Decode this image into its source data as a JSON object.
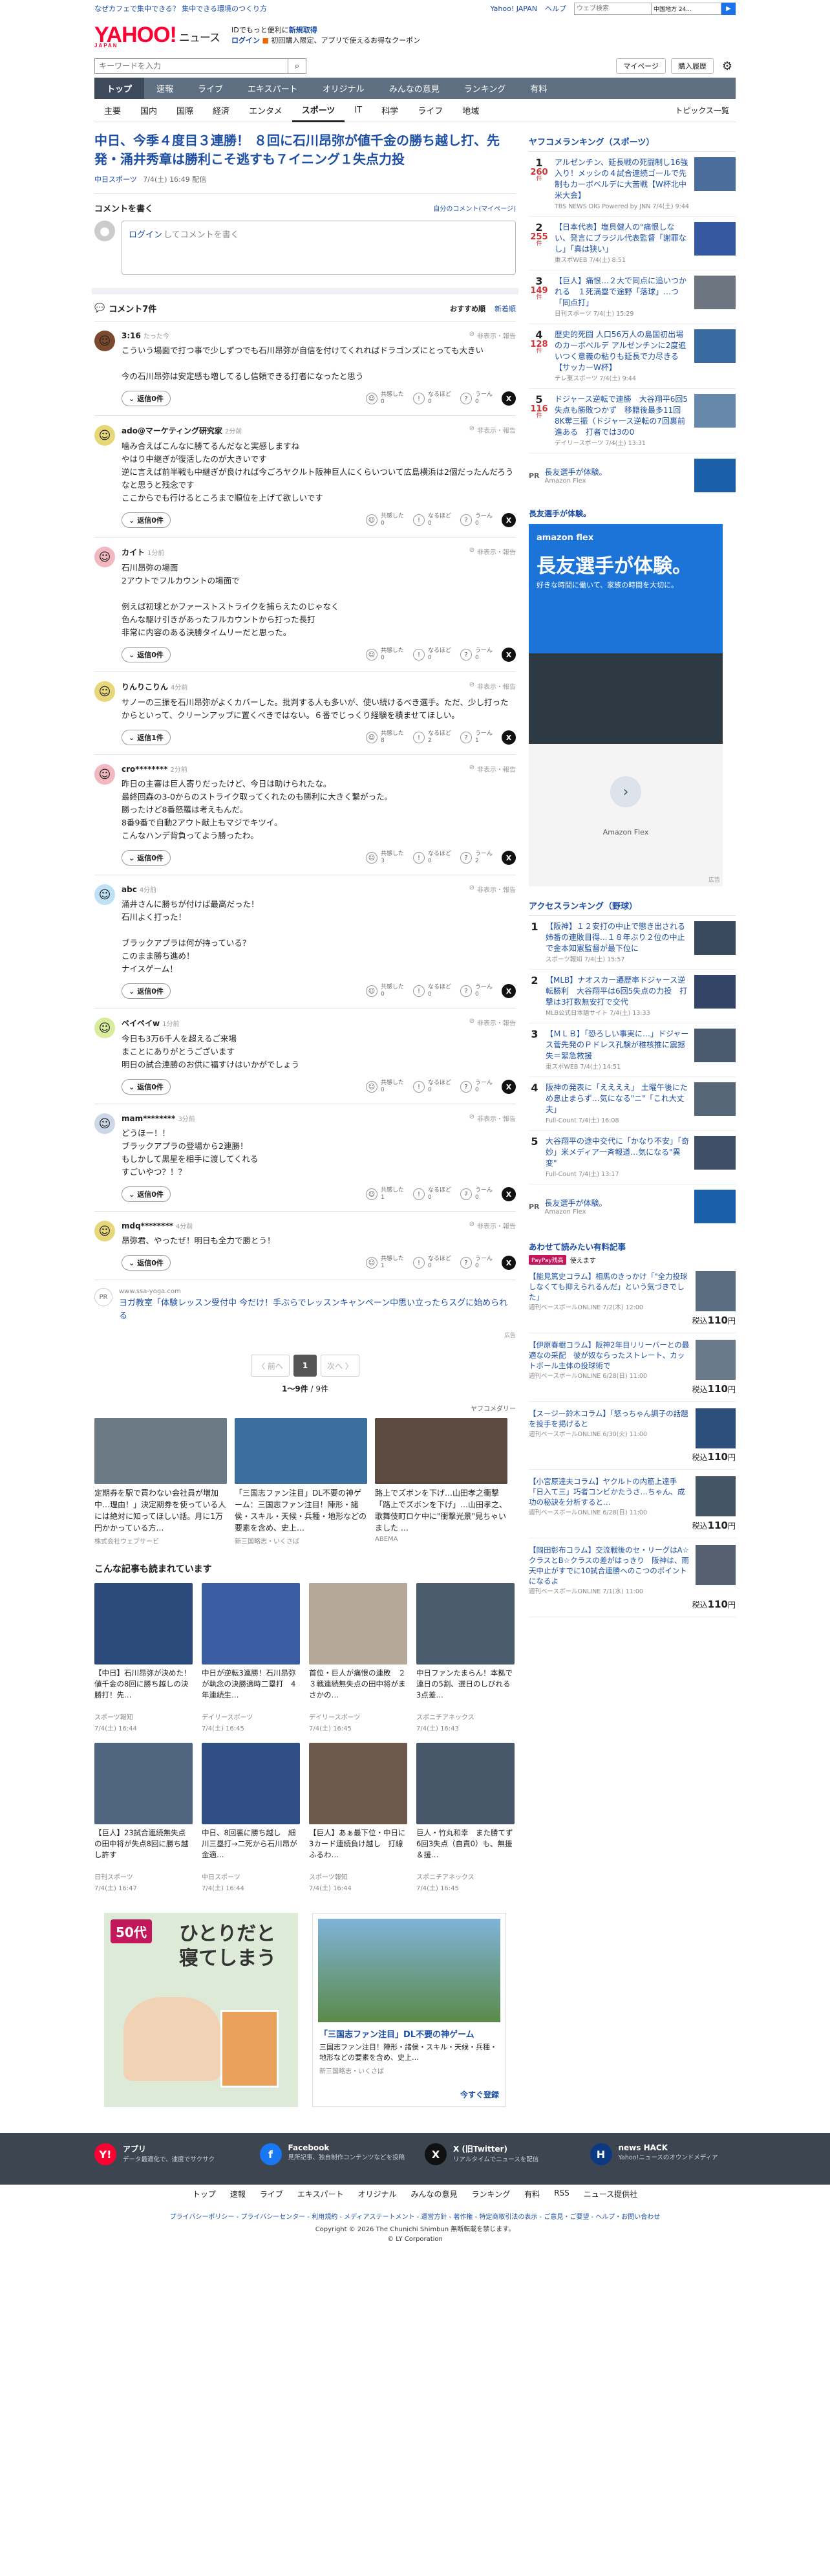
{
  "topbar": {
    "promo": "なぜカフェで集中できる？ 集中できる環境のつくり方",
    "links": [
      "Yahoo! JAPAN",
      "ヘルプ"
    ],
    "search_placeholder": "ウェブ検索",
    "search_select": "中国地方 24...",
    "search_button": "▶"
  },
  "header": {
    "logo": "YAHOO!",
    "logo_sub": "JAPAN",
    "news": "ニュース",
    "promo1_pre": "IDでもっと便利に",
    "promo1_link": "新規取得",
    "promo2_link": "ログイン",
    "promo2_text": "初回購入限定、アプリで使えるお得なクーポン"
  },
  "search": {
    "placeholder": "キーワードを入力",
    "mypage": "マイページ",
    "purchased": "購入履歴"
  },
  "gnav": [
    "トップ",
    "速報",
    "ライブ",
    "エキスパート",
    "オリジナル",
    "みんなの意見",
    "ランキング",
    "有料"
  ],
  "snav": [
    "主要",
    "国内",
    "国際",
    "経済",
    "エンタメ",
    "スポーツ",
    "IT",
    "科学",
    "ライフ",
    "地域"
  ],
  "topics_list": "トピックス一覧",
  "article": {
    "title": "中日、今季４度目３連勝！ ８回に石川昂弥が値千金の勝ち越し打、先発・涌井秀章は勝利こそ逃すも７イニング１失点力投",
    "source": "中日スポーツ",
    "date": "7/4(土) 16:49 配信"
  },
  "comment_form": {
    "heading": "コメントを書く",
    "mine": "自分のコメント(マイページ)",
    "login": "ログイン",
    "placeholder": "してコメントを書く"
  },
  "comments_head": {
    "title": "コメント7件",
    "sort_rec": "おすすめ順",
    "sort_new": "新着順"
  },
  "react_labels": {
    "agree": "共感した",
    "hmm": "なるほど",
    "think": "うーん",
    "reply": "返信0件",
    "report": "非表示・報告"
  },
  "comments": [
    {
      "name": "3:16",
      "ago": "たった今",
      "text": "こういう場面で打つ事で少しずつでも石川昂弥が自信を付けてくれればドラゴンズにとっても大きい\n\n今の石川昂弥は安定感も増してるし信頼できる打者になったと思う",
      "agree": "0",
      "hmm": "0",
      "think": "0",
      "reply": "返信0件",
      "color": "#7b4a2e"
    },
    {
      "name": "ado@マーケティング研究家",
      "ago": "2分前",
      "text": "噛み合えばこんなに勝てるんだなと実感しますね\nやはり中継ぎが復活したのが大きいです\n逆に言えば前半戦も中継ぎが良ければ今ごろヤクルト阪神巨人にくらいついて広島横浜は2個だったんだろうなと思うと残念です\nここからでも行けるところまで順位を上げて欲しいです",
      "agree": "0",
      "hmm": "0",
      "think": "0",
      "reply": "返信0件",
      "color": "#e8d77a"
    },
    {
      "name": "カイト",
      "ago": "1分前",
      "text": "石川昂弥の場面\n2アウトでフルカウントの場面で\n\n例えば初球とかファーストストライクを捕らえたのじゃなく\n色んな駆け引きがあったフルカウントから打った長打\n非常に内容のある決勝タイムリーだと思った。",
      "agree": "0",
      "hmm": "0",
      "think": "0",
      "reply": "返信0件",
      "color": "#f2b8c0"
    },
    {
      "name": "りんりこりん",
      "ago": "4分前",
      "text": "サノーの三振を石川昂弥がよくカバーした。批判する人も多いが、使い続けるべき選手。ただ、少し打ったからといって、クリーンアップに置くべきではない。６番でじっくり経験を積ませてほしい。",
      "agree": "8",
      "hmm": "2",
      "think": "1",
      "reply": "返信1件",
      "color": "#e8d77a"
    },
    {
      "name": "cro********",
      "ago": "2分前",
      "text": "昨日の主審は巨人寄りだったけど、今日は助けられたな。\n最終回森の3-0からのストライク取ってくれたのも勝利に大きく繋がった。\n勝ったけど8番怒羅は考えもんだ。\n8番9番で自動2アウト献上もマジでキツイ。\nこんなハンデ背負ってよう勝ったわ。",
      "agree": "3",
      "hmm": "0",
      "think": "2",
      "reply": "返信0件",
      "color": "#f2b8c0"
    },
    {
      "name": "abc",
      "ago": "4分前",
      "text": "涌井さんに勝ちが付けば最高だった！\n石川よく打った！\n\nブラックアプラは何が持っている？\nこのまま勝ち進め！\nナイスゲーム！",
      "agree": "0",
      "hmm": "0",
      "think": "0",
      "reply": "返信0件",
      "color": "#bfe1f5"
    },
    {
      "name": "ペイペイw",
      "ago": "1分前",
      "text": "今日も3万6千人を超えるご来場\nまことにありがとうございます\n明日の試合連勝のお供に福すけはいかがでしょう",
      "agree": "0",
      "hmm": "0",
      "think": "0",
      "reply": "返信0件",
      "color": "#d9ec9c"
    },
    {
      "name": "mam********",
      "ago": "3分前",
      "text": "どうほー！！\nブラックアプラの登場から2連勝！\nもしかして黒星を相手に渡してくれる\nすごいやつ？！？",
      "agree": "1",
      "hmm": "0",
      "think": "0",
      "reply": "返信0件",
      "color": "#ccd8e8"
    },
    {
      "name": "mdq********",
      "ago": "4分前",
      "text": "昂弥君、やったぜ！明日も全力で勝とう！",
      "agree": "1",
      "hmm": "0",
      "think": "0",
      "reply": "返信0件",
      "color": "#e8d77a"
    }
  ],
  "comment_ad": {
    "pr": "PR",
    "source": "www.ssa-yoga.com",
    "text": "ヨガ教室「体験レッスン受付中 今だけ！手ぶらでレッスンキャンペーン中思い立ったらスグに始められる",
    "adlabel": "広告"
  },
  "pager": {
    "prev": "〈 前へ",
    "current": "1",
    "next": "次へ 〉",
    "count": "1〜9件",
    "total": " / 9件"
  },
  "yahoo_partner": "ヤフコメダリー",
  "features": [
    {
      "title": "定期券を駅で買わない会社員が増加中…理由！」決定期券を使っている人には絶対に知ってほしい話。月に1万円かかっている方…",
      "source": "株式会社ウェブサービ",
      "color": "#6c7a86"
    },
    {
      "title": "「三国志ファン注目」DL不要の神ゲーム：三国志ファン注目！陣形・諸侯・スキル・天候・兵種・地形などの要素を含め、史上…",
      "source": "新三国略志・いくさば",
      "color": "#3d6f9e"
    },
    {
      "title": "路上でズボンを下げ…山田孝之衝撃「路上でズボンを下げ」…山田孝之、歌舞伎町ロケ中に\"衝撃光景\"見ちゃいました …",
      "source": "ABEMA",
      "color": "#5a4a3f"
    }
  ],
  "recommended_heading": "こんな記事も読まれています",
  "recommended": [
    {
      "title": "【中日】石川昂弥が決めた！値千金の8回に勝ち越しの決勝打！先…",
      "source": "スポーツ報知",
      "date": "7/4(土) 16:44",
      "color": "#2c4a7c"
    },
    {
      "title": "中日が逆転3連勝！石川昂弥が執念の決勝適時二塁打　4年連続生…",
      "source": "デイリースポーツ",
      "date": "7/4(土) 16:45",
      "color": "#3b5ca0"
    },
    {
      "title": "首位・巨人が痛恨の連敗　２３戦連続無失点の田中将がまさかの…",
      "source": "デイリースポーツ",
      "date": "7/4(土) 16:45",
      "color": "#b5a89a"
    },
    {
      "title": "中日ファンたまらん！本拠で連日の5割、選日のしびれる3点差…",
      "source": "スポニチアネックス",
      "date": "7/4(土) 16:43",
      "color": "#4b5c6d"
    },
    {
      "title": "【巨人】23試合連続無失点の田中将が失点8回に勝ち越し許す",
      "source": "日刊スポーツ",
      "date": "7/4(土) 16:47",
      "color": "#506680"
    },
    {
      "title": "中日、8回裏に勝ち越し　細川三塁打→二死から石川昂が金適…",
      "source": "中日スポーツ",
      "date": "7/4(土) 16:44",
      "color": "#2f4f85"
    },
    {
      "title": "【巨人】あぁ最下位・中日に3カード連続負け越し　打線ふるわ…",
      "source": "スポーツ報知",
      "date": "7/4(土) 16:44",
      "color": "#6d5a4c"
    },
    {
      "title": "巨人・竹丸和幸　また勝てず　6回3失点（自責0）も、無援＆援…",
      "source": "スポニチアネックス",
      "date": "7/4(土) 16:45",
      "color": "#475769"
    }
  ],
  "bottom_ads": {
    "ad1_age": "50代",
    "ad1_title": "ひとりだと寝てしまう",
    "ad2_title": "「三国志ファン注目」DL不要の神ゲーム",
    "ad2_text": "三国志ファン注目！陣形・諸侯・スキル・天候・兵種・地形などの要素を含め、史上…",
    "ad2_source": "新三国略志・いくさば",
    "ad2_cta": "今すぐ登録",
    "adlabel": "広告"
  },
  "ranking": {
    "heading": "ヤフコメランキング（スポーツ）",
    "unit": "件",
    "items": [
      {
        "rank": "1",
        "count": "260",
        "title": "アルゼンチン、延長戦の死闘制し16強入り！メッシの４試合連続ゴールで先制もカーボベルデに大苦戦【W杯北中米大会】",
        "source": "TBS NEWS DIG Powered by JNN",
        "date": "7/4(土) 9:44",
        "color": "#4a6d9c"
      },
      {
        "rank": "2",
        "count": "255",
        "title": "【日本代表】塩貝健人の\"痛恨しない、発言にブラジル代表監督「謝罪なし」「真は狭い」",
        "source": "東スポWEB",
        "date": "7/4(土) 8:51",
        "color": "#3558a0"
      },
      {
        "rank": "3",
        "count": "149",
        "title": "【巨人】痛恨…２大で同点に追いつかれる　１死満塁で途野「落球」…つ「同点打」",
        "source": "日刊スポーツ",
        "date": "7/4(土) 15:29",
        "color": "#6d7580"
      },
      {
        "rank": "4",
        "count": "128",
        "title": "歴史的死闘 人口56万人の島国初出場のカーボベルデ アルゼンチンに2度追いつく意義の粘りも延長で力尽きる【サッカーW杯】",
        "source": "テレ東スポーツ",
        "date": "7/4(土) 9:44",
        "color": "#3a6ba0"
      },
      {
        "rank": "5",
        "count": "116",
        "title": "ドジャース逆転で連勝　大谷翔平6回5失点も勝敗つかず　移籍後最多11回8K奪三振（ドジャース逆転の7回裏前進ある　打者では3の0",
        "source": "デイリースポーツ",
        "date": "7/4(土) 13:31",
        "color": "#6688aa"
      }
    ],
    "pr_title": "長友選手が体験。",
    "pr_source": "Amazon Flex",
    "pr": "PR"
  },
  "side_ad": {
    "label": "長友選手が体験。",
    "big": "長友選手が体験。",
    "sub": "好きな時間に働いて、家族の時間を大切に。",
    "brand": "amazon flex",
    "name": "Amazon Flex",
    "adlabel": "広告"
  },
  "access": {
    "heading": "アクセスランキング（野球）",
    "items": [
      {
        "rank": "1",
        "title": "【阪神】１２安打の中止で懲き出される姉番の連敗目得...１８年ぶり２位の中止で金本知憲監督が最下位に",
        "source": "スポーツ報知",
        "date": "7/4(土) 15:57",
        "color": "#3a4a5e"
      },
      {
        "rank": "2",
        "title": "【MLB】ナオスカー遷歴率ドジャース逆転勝利　大谷翔平は6回5失点の力投　打撃は3打数無安打で交代",
        "source": "MLB公式日本語サイト",
        "date": "7/4(土) 13:33",
        "color": "#334466"
      },
      {
        "rank": "3",
        "title": "【ＭＬＢ】「恐ろしい事実に…」ドジャース菅先発のＰドレス孔験が稚核推に震撼失＝緊急救援",
        "source": "東スポWEB",
        "date": "7/4(土) 14:51",
        "color": "#4a5a6e"
      },
      {
        "rank": "4",
        "title": "阪神の発表に「ええええ」 土曜午後にため息止まらず…気になる\"ニ\"「これ大丈夫」",
        "source": "Full-Count",
        "date": "7/4(土) 16:08",
        "color": "#556677"
      },
      {
        "rank": "5",
        "title": "大谷翔平の途中交代に「かなり不安」「奇妙」米メディア一斉報道…気になる\"異変\"",
        "source": "Full-Count",
        "date": "7/4(土) 13:17",
        "color": "#3f4f66"
      }
    ],
    "pr_title": "長友選手が体験。",
    "pr_source": "Amazon Flex",
    "pr": "PR"
  },
  "sale": {
    "heading": "あわせて読みたい有料記事",
    "sub_badge": "PayPay残高",
    "sub_text": "使えます",
    "price_pre": "税込",
    "price": "110",
    "price_unit": "円",
    "items": [
      {
        "title": "【能見篤史コラム】相馬のきっかけ「\"全力投球しなくても抑えられるんだ」という気づきでした」",
        "source": "週刊ベースボールONLINE",
        "date": "7/2(木) 12:00",
        "color": "#5a6c80"
      },
      {
        "title": "【伊原春樹コラム】阪神2年目リリーバーとの最適なの采配　彼が奴ならったストレート、カットボール主体の投球術で",
        "source": "週刊ベースボールONLINE",
        "date": "6/28(日) 11:00",
        "color": "#6a7a8a"
      },
      {
        "title": "【スージー鈴木コラム】「怒っちゃん調子の話題を投手を掲げると",
        "source": "週刊ベースボールONLINE",
        "date": "6/30(火) 11:00",
        "color": "#2d4f7c"
      },
      {
        "title": "【小宮原達夫コラム】ヤクルトの内筋上達手「日入て三」巧者コンビかたうさ…ちゃん、成功の秘訣を分析すると…",
        "source": "週刊ベースボールONLINE",
        "date": "6/28(日) 11:00",
        "color": "#445566"
      },
      {
        "title": "【岡田彰布コラム】交流戦後のセ・リーグはA☆クラスとB☆クラスの差がはっきり　阪神は、雨天中止がすでに10試合連勝へのこつのポイントになるよ",
        "source": "週刊ベースボールONLINE",
        "date": "7/1(水) 11:00",
        "color": "#556070"
      }
    ]
  },
  "footer": {
    "items": [
      {
        "title": "アプリ",
        "text": "データ最適化で、速度でサクサク",
        "icon": "Y!",
        "color": "#ff0033"
      },
      {
        "title": "Facebook",
        "text": "見所記事、独自制作コンテンツなどを投稿",
        "icon": "f",
        "color": "#1877f2"
      },
      {
        "title": "X (旧Twitter)",
        "text": "リアルタイムでニュースを配信",
        "icon": "X",
        "color": "#111"
      },
      {
        "title": "news HACK",
        "text": "Yahoo!ニュースのオウンドメディア",
        "icon": "H",
        "color": "#0b3a82"
      }
    ],
    "nav": [
      "トップ",
      "速報",
      "ライブ",
      "エキスパート",
      "オリジナル",
      "みんなの意見",
      "ランキング",
      "有料",
      "RSS",
      "ニュース提供社"
    ],
    "links": "プライバシーポリシー - プライバシーセンター - 利用規約 - メディアステートメント - 運営方針 - 著作権 - 特定商取引法の表示 - ご意見・ご要望 - ヘルプ・お問い合わせ",
    "copy1": "Copyright © 2026 The Chunichi Shimbun 無断転載を禁じます。",
    "copy2": "© LY Corporation"
  }
}
